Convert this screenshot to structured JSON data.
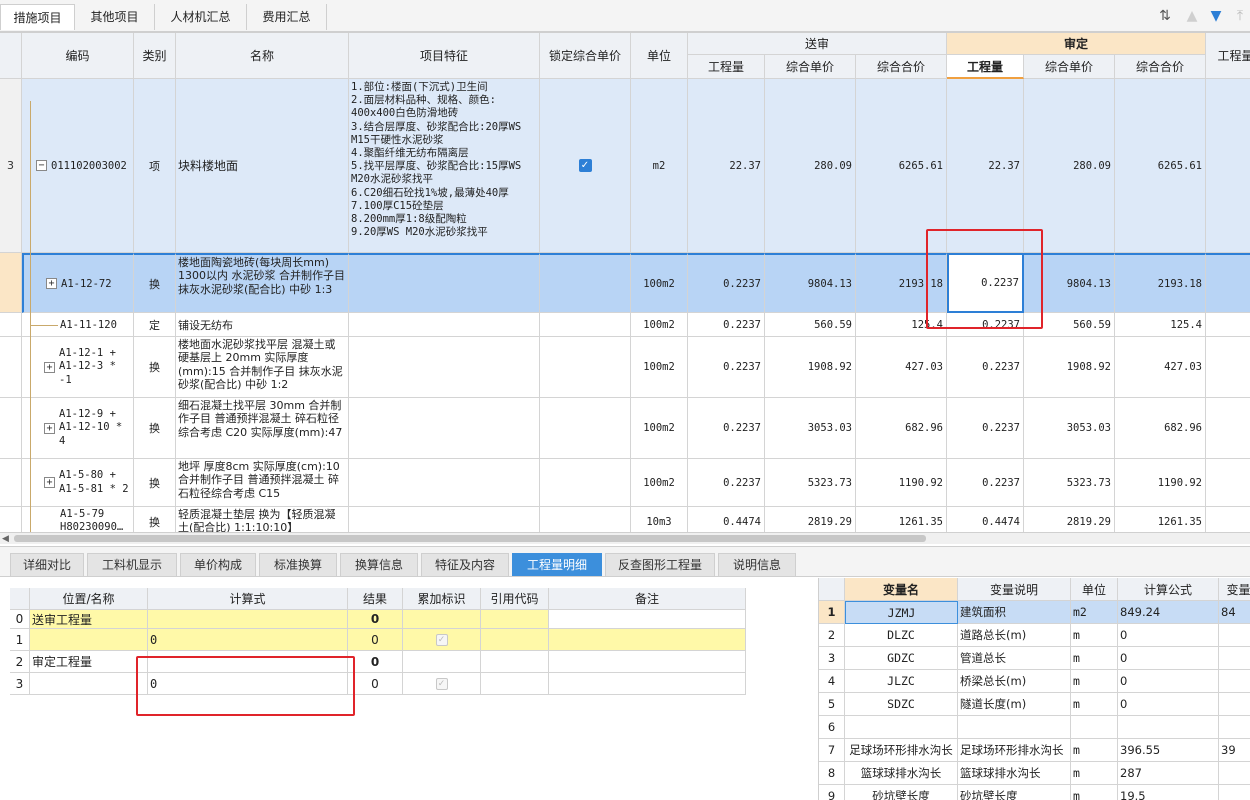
{
  "top_tabs": [
    "措施项目",
    "其他项目",
    "人材机汇总",
    "费用汇总"
  ],
  "toolbar_icons": [
    "sort-icon",
    "move-up-icon",
    "move-down-icon",
    "move-top-icon"
  ],
  "grid": {
    "headers": {
      "code": "编码",
      "type": "类别",
      "name": "名称",
      "feature": "项目特征",
      "lock": "锁定综合单价",
      "unit": "单位",
      "submit_group": "送审",
      "approve_group": "审定",
      "qty": "工程量",
      "unit_price": "综合单价",
      "total_price": "综合合价",
      "extra": "工程量"
    },
    "rows": [
      {
        "num": "3",
        "code": "011102003002",
        "type": "项",
        "name": "块料楼地面",
        "features": [
          "1.部位:楼面(下沉式)卫生间",
          "2.面层材料品种、规格、颜色:",
          "400x400白色防滑地砖",
          "3.结合层厚度、砂浆配合比:20厚WS",
          "M15干硬性水泥砂浆",
          "4.聚酯纤维无纺布隔离层",
          "5.找平层厚度、砂浆配合比:15厚WS",
          "M20水泥砂浆找平",
          "6.C20细石砼找1%坡,最薄处40厚",
          "7.100厚C15砼垫层",
          "8.200mm厚1:8级配陶粒",
          "9.20厚WS M20水泥砂浆找平"
        ],
        "unit": "m2",
        "s_qty": "22.37",
        "s_price": "280.09",
        "s_total": "6265.61",
        "a_qty": "22.37",
        "a_price": "280.09",
        "a_total": "6265.61"
      },
      {
        "code": "A1-12-72",
        "type": "换",
        "name": "楼地面陶瓷地砖(每块周长mm) 1300以内 水泥砂浆 合并制作子目 抹灰水泥砂浆(配合比) 中砂 1:3",
        "unit": "100m2",
        "s_qty": "0.2237",
        "s_price": "9804.13",
        "s_total": "2193.18",
        "a_qty": "0.2237",
        "a_price": "9804.13",
        "a_total": "2193.18"
      },
      {
        "code": "A1-11-120",
        "type": "定",
        "name": "铺设无纺布",
        "unit": "100m2",
        "s_qty": "0.2237",
        "s_price": "560.59",
        "s_total": "125.4",
        "a_qty": "0.2237",
        "a_price": "560.59",
        "a_total": "125.4"
      },
      {
        "code": "A1-12-1 + A1-12-3 * -1",
        "type": "换",
        "name": "楼地面水泥砂浆找平层 混凝土或硬基层上 20mm 实际厚度(mm):15 合并制作子目 抹灰水泥砂浆(配合比) 中砂 1:2",
        "unit": "100m2",
        "s_qty": "0.2237",
        "s_price": "1908.92",
        "s_total": "427.03",
        "a_qty": "0.2237",
        "a_price": "1908.92",
        "a_total": "427.03"
      },
      {
        "code": "A1-12-9 + A1-12-10 * 4",
        "type": "换",
        "name": "细石混凝土找平层 30mm 合并制作子目 普通预拌混凝土 碎石粒径综合考虑 C20 实际厚度(mm):47",
        "unit": "100m2",
        "s_qty": "0.2237",
        "s_price": "3053.03",
        "s_total": "682.96",
        "a_qty": "0.2237",
        "a_price": "3053.03",
        "a_total": "682.96"
      },
      {
        "code": "A1-5-80 + A1-5-81 * 2",
        "type": "换",
        "name": "地坪 厚度8cm 实际厚度(cm):10 合并制作子目 普通预拌混凝土 碎石粒径综合考虑 C15",
        "unit": "100m2",
        "s_qty": "0.2237",
        "s_price": "5323.73",
        "s_total": "1190.92",
        "a_qty": "0.2237",
        "a_price": "5323.73",
        "a_total": "1190.92"
      },
      {
        "code": "A1-5-79 H80230090…",
        "type": "换",
        "name": "轻质混凝土垫层 换为【轻质混凝土(配合比) 1:1:10:10】",
        "unit": "10m3",
        "s_qty": "0.4474",
        "s_price": "2819.29",
        "s_total": "1261.35",
        "a_qty": "0.4474",
        "a_price": "2819.29",
        "a_total": "1261.35"
      }
    ]
  },
  "bottom_tabs": [
    "详细对比",
    "工料机显示",
    "单价构成",
    "标准换算",
    "换算信息",
    "特征及内容",
    "工程量明细",
    "反查图形工程量",
    "说明信息"
  ],
  "bottom_active": "工程量明细",
  "qty_table": {
    "headers": [
      "位置/名称",
      "计算式",
      "结果",
      "累加标识",
      "引用代码",
      "备注"
    ],
    "rows": [
      {
        "num": "0",
        "name": "送审工程量",
        "formula": "",
        "result": "0",
        "check": false
      },
      {
        "num": "1",
        "name": "",
        "formula": "0",
        "result": "0",
        "check": true
      },
      {
        "num": "2",
        "name": "审定工程量",
        "formula": "",
        "result": "0",
        "check": false
      },
      {
        "num": "3",
        "name": "",
        "formula": "0",
        "result": "0",
        "check": true
      }
    ]
  },
  "var_table": {
    "headers": [
      "变量名",
      "变量说明",
      "单位",
      "计算公式",
      "变量"
    ],
    "rows": [
      {
        "num": "1",
        "name": "JZMJ",
        "desc": "建筑面积",
        "unit": "m2",
        "formula": "849.24",
        "val": "84"
      },
      {
        "num": "2",
        "name": "DLZC",
        "desc": "道路总长(m)",
        "unit": "m",
        "formula": "0",
        "val": ""
      },
      {
        "num": "3",
        "name": "GDZC",
        "desc": "管道总长",
        "unit": "m",
        "formula": "0",
        "val": ""
      },
      {
        "num": "4",
        "name": "JLZC",
        "desc": "桥梁总长(m)",
        "unit": "m",
        "formula": "0",
        "val": ""
      },
      {
        "num": "5",
        "name": "SDZC",
        "desc": "隧道长度(m)",
        "unit": "m",
        "formula": "0",
        "val": ""
      },
      {
        "num": "6",
        "name": "",
        "desc": "",
        "unit": "",
        "formula": "",
        "val": ""
      },
      {
        "num": "7",
        "name": "足球场环形排水沟长",
        "desc": "足球场环形排水沟长",
        "unit": "m",
        "formula": "396.55",
        "val": "39"
      },
      {
        "num": "8",
        "name": "篮球球排水沟长",
        "desc": "篮球球排水沟长",
        "unit": "m",
        "formula": "287",
        "val": ""
      },
      {
        "num": "9",
        "name": "砂坑壁长度",
        "desc": "砂坑壁长度",
        "unit": "m",
        "formula": "19.5",
        "val": ""
      }
    ]
  }
}
